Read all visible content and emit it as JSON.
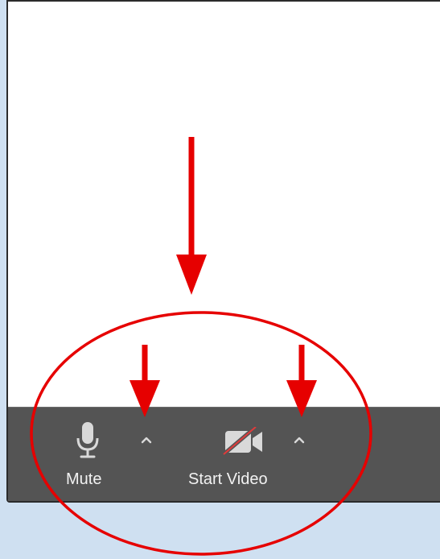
{
  "toolbar": {
    "mute_label": "Mute",
    "start_video_label": "Start Video"
  },
  "colors": {
    "toolbar_bg": "#545454",
    "annotation_red": "#e60000",
    "page_bg": "#cfe0f1"
  },
  "icons": {
    "mute": "microphone-icon",
    "audio_options": "caret-up-icon",
    "video": "video-camera-off-icon",
    "video_options": "caret-up-icon"
  }
}
